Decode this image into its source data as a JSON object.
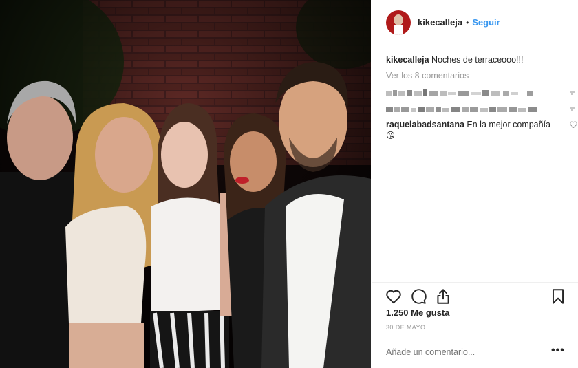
{
  "post": {
    "username": "kikecalleja",
    "dot": "•",
    "follow_label": "Seguir",
    "caption_user": "kikecalleja",
    "caption_text": "Noches de terraceooo!!!",
    "view_all_label": "Ver los 8 comentarios",
    "comment_user": "raquelabadsantana",
    "comment_text": "En la mejor compañía 😘",
    "likes": "1.250 Me gusta",
    "date": "30 DE MAYO",
    "add_comment_placeholder": "Añade un comentario...",
    "more_label": "•••"
  },
  "icons": {
    "like": "heart-icon",
    "comment": "comment-icon",
    "share": "share-icon",
    "save": "bookmark-icon"
  },
  "colors": {
    "link": "#3897f0",
    "text": "#262626",
    "muted": "#999999"
  }
}
